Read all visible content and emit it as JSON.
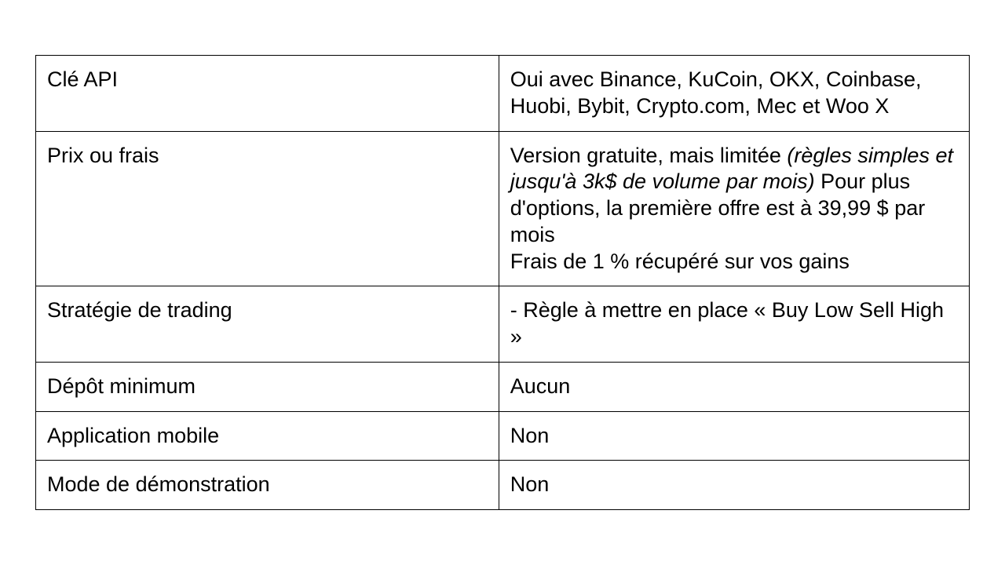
{
  "table": {
    "row0": {
      "label": "Clé API",
      "value": "Oui avec Binance, KuCoin, OKX, Coinbase, Huobi, Bybit, Crypto.com, Mec et Woo X"
    },
    "row1": {
      "label": "Prix ou frais",
      "val_part1": "Version gratuite, mais limitée ",
      "val_italic": "(règles simples et jusqu'à 3k$ de volume par mois)",
      "val_part2": " Pour plus d'options, la première offre est à 39,99 $ par mois",
      "val_part3": "Frais de 1 % récupéré sur vos gains"
    },
    "row2": {
      "label": "Stratégie de trading",
      "value": "- Règle à mettre en place « Buy Low Sell High »"
    },
    "row3": {
      "label": "Dépôt minimum",
      "value": "Aucun"
    },
    "row4": {
      "label": "Application mobile",
      "value": "Non"
    },
    "row5": {
      "label": "Mode de démonstration",
      "value": "Non"
    }
  }
}
